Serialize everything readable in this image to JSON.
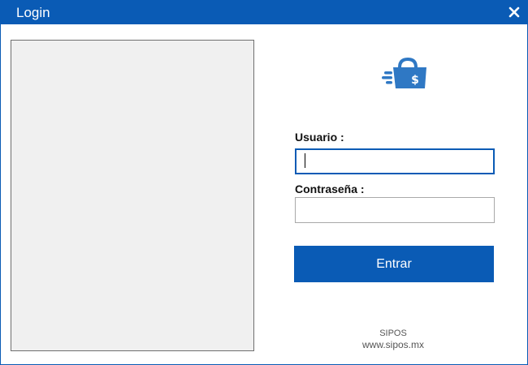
{
  "window": {
    "title": "Login",
    "close_icon": "close-icon"
  },
  "logo": {
    "icon": "shopping-bag-dollar-icon",
    "color": "#2f78c4"
  },
  "form": {
    "username_label": "Usuario :",
    "username_value": "",
    "password_label": "Contraseña :",
    "password_value": "",
    "submit_label": "Entrar"
  },
  "footer": {
    "brand": "SIPOS",
    "website": "www.sipos.mx"
  },
  "colors": {
    "accent": "#0a5bb5",
    "panel_background": "#f0f0f0",
    "input_border": "#a9a9a9"
  }
}
